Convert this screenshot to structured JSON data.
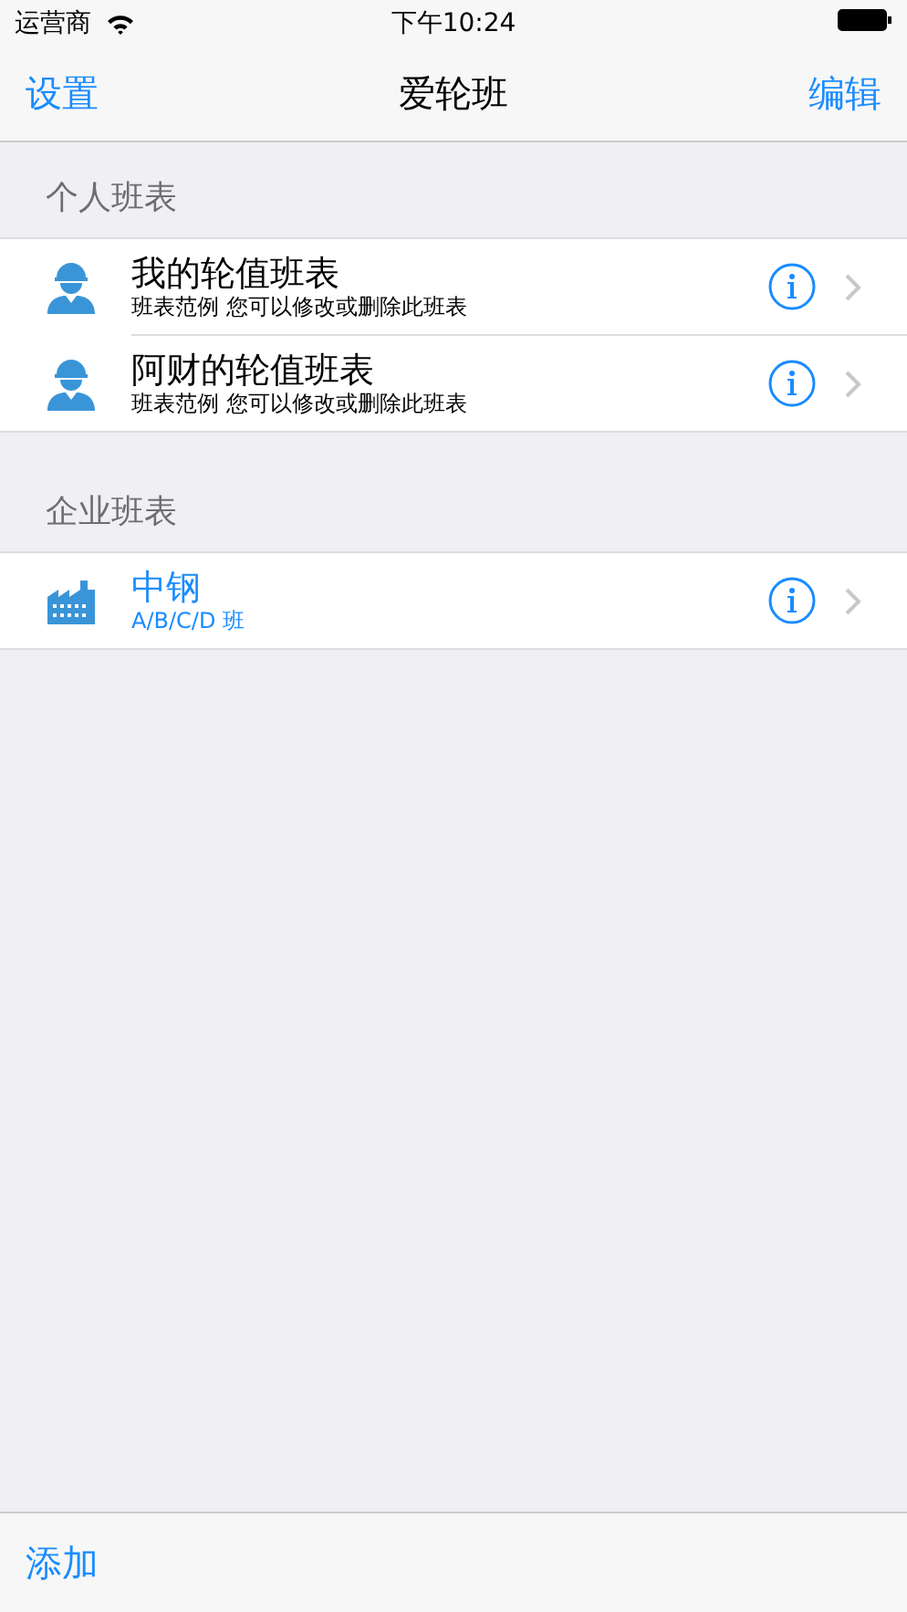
{
  "status_bar": {
    "carrier": "运营商",
    "time": "下午10:24"
  },
  "nav": {
    "left": "设置",
    "title": "爱轮班",
    "right": "编辑"
  },
  "sections": [
    {
      "header": "个人班表",
      "rows": [
        {
          "kind": "person",
          "title": "我的轮值班表",
          "subtitle": "班表范例 您可以修改或删除此班表"
        },
        {
          "kind": "person",
          "title": "阿财的轮值班表",
          "subtitle": "班表范例 您可以修改或删除此班表"
        }
      ]
    },
    {
      "header": "企业班表",
      "rows": [
        {
          "kind": "company",
          "title": "中钢",
          "subtitle": "A/B/C/D 班"
        }
      ]
    }
  ],
  "toolbar": {
    "add": "添加"
  }
}
